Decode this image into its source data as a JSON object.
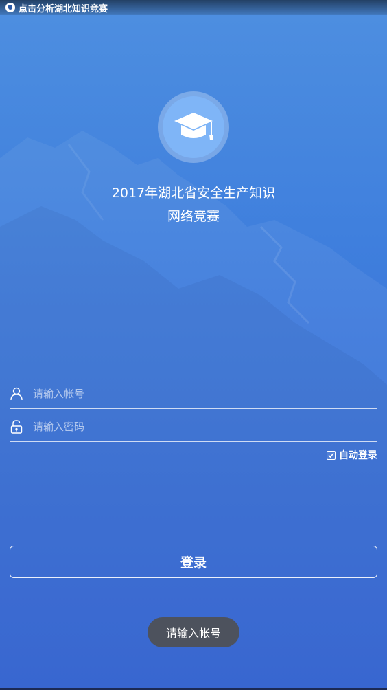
{
  "status_bar": {
    "notification_text": "点击分析湖北知识竞赛",
    "app_icon": "shield-icon"
  },
  "logo": {
    "icon": "graduation-cap-icon"
  },
  "header": {
    "title": "2017年湖北省安全生产知识",
    "subtitle": "网络竞赛"
  },
  "form": {
    "username": {
      "placeholder": "请输入帐号",
      "value": "",
      "icon": "user-icon"
    },
    "password": {
      "placeholder": "请输入密码",
      "value": "",
      "icon": "lock-icon"
    },
    "auto_login": {
      "label": "自动登录",
      "checked": true
    },
    "login_label": "登录"
  },
  "toast": {
    "message": "请输入帐号"
  },
  "colors": {
    "background_top": "#4e8fe0",
    "background_bottom": "#2f62d6",
    "logo_fill": "#7fb5f7",
    "toast_bg": "#505050"
  }
}
